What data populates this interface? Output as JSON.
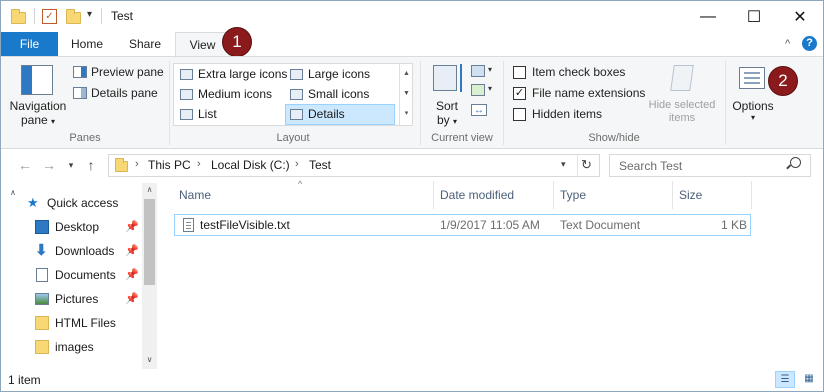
{
  "window": {
    "title": "Test",
    "minimize_glyph": "—",
    "maximize_glyph": "☐",
    "close_glyph": "✕"
  },
  "tabs": [
    {
      "label": "File"
    },
    {
      "label": "Home"
    },
    {
      "label": "Share"
    },
    {
      "label": "View"
    }
  ],
  "badges": [
    "1",
    "2"
  ],
  "ribbon": {
    "panes": {
      "navigation_pane_line1": "Navigation",
      "navigation_pane_line2": "pane",
      "preview_pane": "Preview pane",
      "details_pane": "Details pane",
      "label": "Panes"
    },
    "layout": {
      "items": [
        "Extra large icons",
        "Large icons",
        "Medium icons",
        "Small icons",
        "List",
        "Details"
      ],
      "selected": "Details",
      "label": "Layout"
    },
    "current_view": {
      "sort_by_line1": "Sort",
      "sort_by_line2": "by",
      "label": "Current view"
    },
    "show_hide": {
      "item_check_boxes": "Item check boxes",
      "file_name_extensions": "File name extensions",
      "hidden_items": "Hidden items",
      "hide_selected_line1": "Hide selected",
      "hide_selected_line2": "items",
      "label": "Show/hide",
      "checks": {
        "item_check_boxes": false,
        "file_name_extensions": true,
        "hidden_items": false
      }
    },
    "options": {
      "label": "Options"
    }
  },
  "address": {
    "crumbs": [
      "This PC",
      "Local Disk (C:)",
      "Test"
    ],
    "search_placeholder": "Search Test"
  },
  "nav": {
    "items": [
      {
        "label": "Quick access",
        "icon": "star-icon",
        "pinned": false
      },
      {
        "label": "Desktop",
        "icon": "desktop-icon",
        "pinned": true
      },
      {
        "label": "Downloads",
        "icon": "download-icon",
        "pinned": true
      },
      {
        "label": "Documents",
        "icon": "documents-icon",
        "pinned": true
      },
      {
        "label": "Pictures",
        "icon": "pictures-icon",
        "pinned": true
      },
      {
        "label": "HTML Files",
        "icon": "folder-icon",
        "pinned": false
      },
      {
        "label": "images",
        "icon": "folder-icon",
        "pinned": false
      }
    ]
  },
  "files": {
    "columns": [
      "Name",
      "Date modified",
      "Type",
      "Size"
    ],
    "rows": [
      {
        "name": "testFileVisible.txt",
        "date": "1/9/2017 11:05 AM",
        "type": "Text Document",
        "size": "1 KB"
      }
    ]
  },
  "status": {
    "count": "1 item"
  },
  "colors": {
    "accent": "#1979ca",
    "badge": "#8a1a1c",
    "selection": "#cce8ff"
  }
}
